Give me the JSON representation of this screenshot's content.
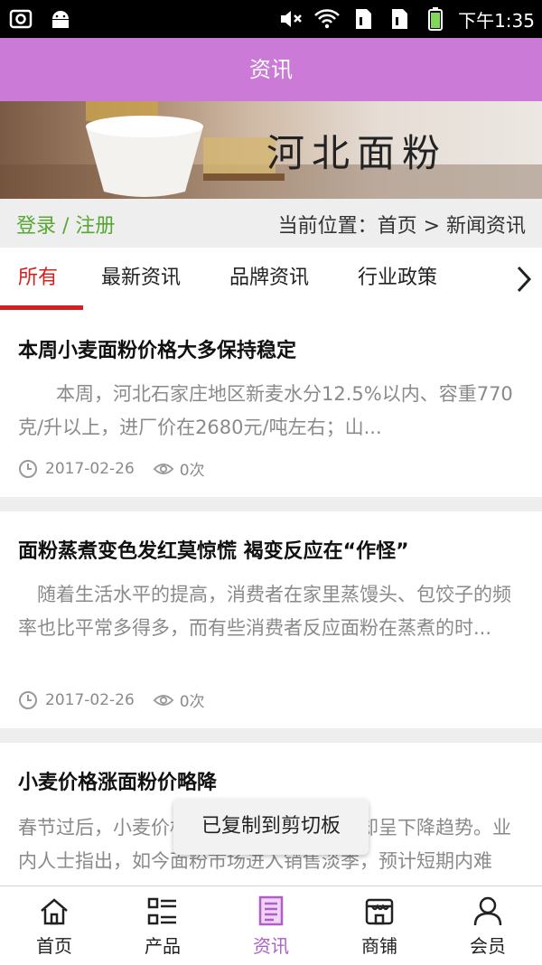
{
  "status_bar": {
    "time": "下午1:35",
    "left_icons": [
      "camera-icon",
      "android-icon"
    ],
    "right_icons": [
      "mute-icon",
      "wifi-icon",
      "sim1-icon",
      "sim2-icon",
      "battery-icon"
    ]
  },
  "header": {
    "title": "资讯"
  },
  "banner": {
    "title": "河北面粉"
  },
  "account": {
    "login_register": "登录 / 注册"
  },
  "breadcrumb": {
    "text": "当前位置：首页 > 新闻资讯"
  },
  "tabs": [
    {
      "label": "所有",
      "active": true
    },
    {
      "label": "最新资讯"
    },
    {
      "label": "品牌资讯"
    },
    {
      "label": "行业政策"
    }
  ],
  "articles": [
    {
      "title": "本周小麦面粉价格大多保持稳定",
      "summary": "　　本周，河北石家庄地区新麦水分12.5%以内、容重770克/升以上，进厂价在2680元/吨左右；山...",
      "date": "2017-02-26",
      "views": "0次"
    },
    {
      "title": "面粉蒸煮变色发红莫惊慌 褐变反应在“作怪”",
      "summary": "　随着生活水平的提高，消费者在家里蒸馒头、包饺子的频率也比平常多得多，而有些消费者反应面粉在蒸煮的时...",
      "date": "2017-02-26",
      "views": "0次"
    },
    {
      "title": "小麦价格涨面粉价略降",
      "summary": "春节过后，小麦价格小幅上涨，面粉价格却呈下降趋势。业内人士指出，如今面粉市场进入销售淡季，预计短期内难以...",
      "date": "",
      "views": ""
    }
  ],
  "toast": {
    "text": "已复制到剪切板"
  },
  "bottom_nav": [
    {
      "label": "首页",
      "icon": "home-icon"
    },
    {
      "label": "产品",
      "icon": "list-icon"
    },
    {
      "label": "资讯",
      "icon": "news-icon",
      "active": true
    },
    {
      "label": "商铺",
      "icon": "store-icon"
    },
    {
      "label": "会员",
      "icon": "user-icon"
    }
  ],
  "colors": {
    "header": "#cc7ad8",
    "active_tab": "#d32020",
    "login": "#56a832",
    "nav_active": "#b05fc6"
  }
}
